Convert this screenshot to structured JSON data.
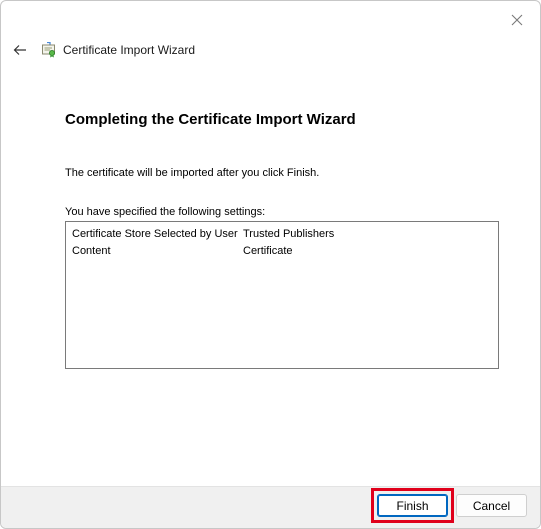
{
  "window": {
    "title": "Certificate Import Wizard",
    "close_icon": "close-icon",
    "back_icon": "back-arrow-icon",
    "cert_icon": "certificate-icon"
  },
  "main": {
    "heading": "Completing the Certificate Import Wizard",
    "intro": "The certificate will be imported after you click Finish.",
    "settings_label": "You have specified the following settings:",
    "settings": [
      {
        "key": "Certificate Store Selected by User",
        "value": "Trusted Publishers"
      },
      {
        "key": "Content",
        "value": "Certificate"
      }
    ]
  },
  "footer": {
    "finish_label": "Finish",
    "cancel_label": "Cancel"
  },
  "colors": {
    "accent": "#0067c0",
    "highlight": "#e0001b",
    "footer_bg": "#f0f0f0"
  }
}
